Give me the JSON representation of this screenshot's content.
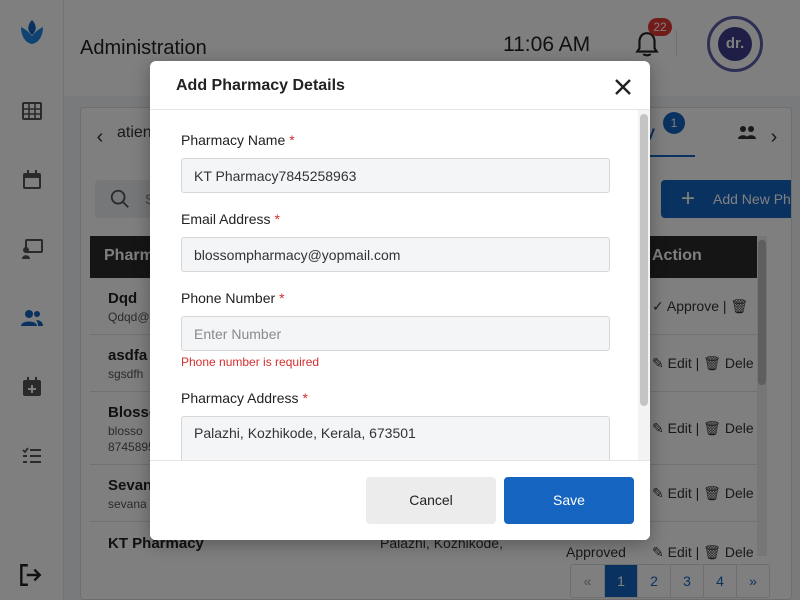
{
  "topbar": {
    "title": "Administration",
    "time": "11:06 AM",
    "notification_count": "22",
    "avatar_text": "dr."
  },
  "sidebar": {
    "items": [
      {
        "icon": "logo-icon"
      },
      {
        "icon": "grid-icon"
      },
      {
        "icon": "calendar-icon"
      },
      {
        "icon": "presentation-icon"
      },
      {
        "icon": "users-icon",
        "active": true
      },
      {
        "icon": "calendar-plus-icon"
      },
      {
        "icon": "list-icon"
      },
      {
        "icon": "logout-icon"
      }
    ],
    "accent_color": "#1565c0"
  },
  "tabs": {
    "partial_left": "atien",
    "active_label": "cy",
    "active_badge": "1"
  },
  "toolbar": {
    "search_placeholder": "S",
    "add_new_label": "Add New Ph"
  },
  "table": {
    "headers": {
      "pharmacy": "Pharm",
      "action": "Action"
    },
    "rows": [
      {
        "name": "Dqd",
        "sub": "Qdqd@",
        "sub2": "",
        "action1": "Approve",
        "action2": "",
        "status": "",
        "address": ""
      },
      {
        "name": "asdfa",
        "sub": "sgsdfh",
        "sub2": "",
        "action1": "Edit",
        "action2": "Dele",
        "status": "",
        "address": ""
      },
      {
        "name": "Blosso",
        "sub": "blosso",
        "sub2": "8745895",
        "action1": "Edit",
        "action2": "Dele",
        "status": "",
        "address": ""
      },
      {
        "name": "Sevan",
        "sub": "sevana",
        "sub2": "",
        "action1": "Edit",
        "action2": "Dele",
        "status": "",
        "address": ""
      },
      {
        "name": "KT Pharmacy",
        "sub": "",
        "sub2": "",
        "action1": "Edit",
        "action2": "Dele",
        "status": "Approved",
        "address": "Palazhi, Kozhikode,"
      }
    ]
  },
  "pagination": {
    "prev": "«",
    "pages": [
      "1",
      "2",
      "3",
      "4"
    ],
    "next": "»",
    "current": "1"
  },
  "modal": {
    "title": "Add Pharmacy Details",
    "fields": {
      "pharmacy_name": {
        "label": "Pharmacy Name",
        "value": "KT Pharmacy7845258963"
      },
      "email": {
        "label": "Email Address",
        "value": "blossompharmacy@yopmail.com"
      },
      "phone": {
        "label": "Phone Number",
        "value": "",
        "placeholder": "Enter Number",
        "error": "Phone number is required"
      },
      "address": {
        "label": "Pharmacy Address",
        "value": "Palazhi, Kozhikode, Kerala, 673501"
      }
    },
    "required_marker": "*",
    "cancel_label": "Cancel",
    "save_label": "Save"
  }
}
